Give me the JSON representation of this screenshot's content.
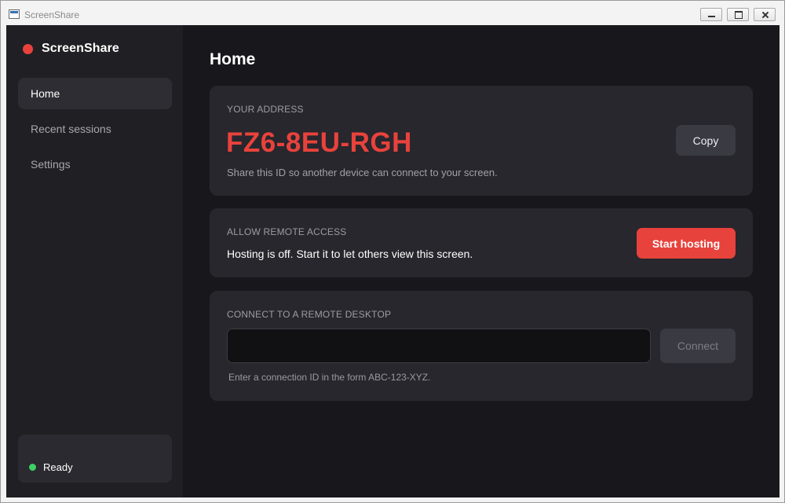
{
  "window": {
    "title": "ScreenShare"
  },
  "sidebar": {
    "brand": "ScreenShare",
    "items": [
      {
        "label": "Home",
        "active": true
      },
      {
        "label": "Recent sessions",
        "active": false
      },
      {
        "label": "Settings",
        "active": false
      }
    ],
    "status": "Ready"
  },
  "main": {
    "title": "Home",
    "address_card": {
      "label": "YOUR ADDRESS",
      "address": "FZ6-8EU-RGH",
      "help": "Share this ID so another device can connect to your screen.",
      "copy_label": "Copy"
    },
    "host_card": {
      "label": "ALLOW REMOTE ACCESS",
      "status": "Hosting is off. Start it to let others view this screen.",
      "button_label": "Start hosting"
    },
    "connect_card": {
      "label": "CONNECT TO A REMOTE DESKTOP",
      "input_value": "",
      "input_placeholder": "",
      "button_label": "Connect",
      "help": "Enter a connection ID in the form ABC-123-XYZ."
    }
  },
  "colors": {
    "accent": "#e8423c",
    "status_ok": "#3dd062",
    "background": "#18181c",
    "sidebar": "#202024",
    "card": "#27272d"
  },
  "icons": [
    "app-window-icon",
    "minimize-icon",
    "maximize-icon",
    "close-icon",
    "brand-record-dot-icon",
    "status-dot-icon"
  ]
}
